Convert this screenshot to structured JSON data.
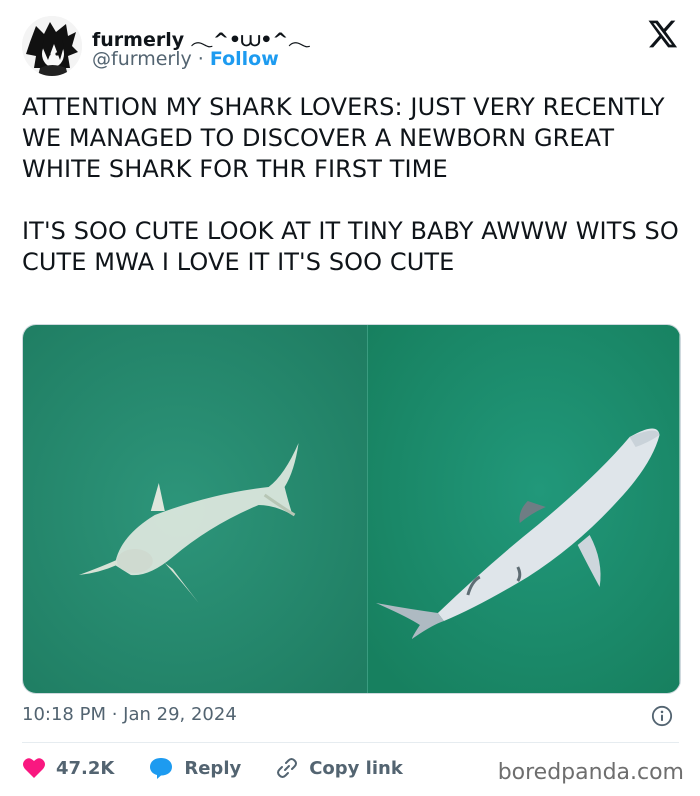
{
  "tweet": {
    "display_name": "furmerly 𓂃^•⩊•^𓂃",
    "handle": "@furmerly",
    "separator": " · ",
    "follow_label": "Follow",
    "text": "ATTENTION MY SHARK LOVERS: JUST VERY RECENTLY WE MANAGED TO DISCOVER A NEWBORN GREAT WHITE SHARK FOR THR FIRST TIME\n\nIT'S SOO CUTE LOOK AT IT TINY BABY AWWW WITS SO CUTE MWA I LOVE IT IT'S SOO CUTE",
    "time": "10:18 PM",
    "date_separator": " · ",
    "date": "Jan 29, 2024"
  },
  "actions": {
    "likes": "47.2K",
    "reply_label": "Reply",
    "copy_link_label": "Copy link"
  },
  "icons": {
    "logo": "x-logo-icon",
    "like": "heart-icon",
    "reply": "speech-bubble-icon",
    "link": "link-icon",
    "info": "info-icon"
  },
  "colors": {
    "accent": "#1d9bf0",
    "heart": "#f91880",
    "water_left": "#25866a",
    "water_right": "#1d8e6c"
  },
  "watermark": "boredpanda.com"
}
